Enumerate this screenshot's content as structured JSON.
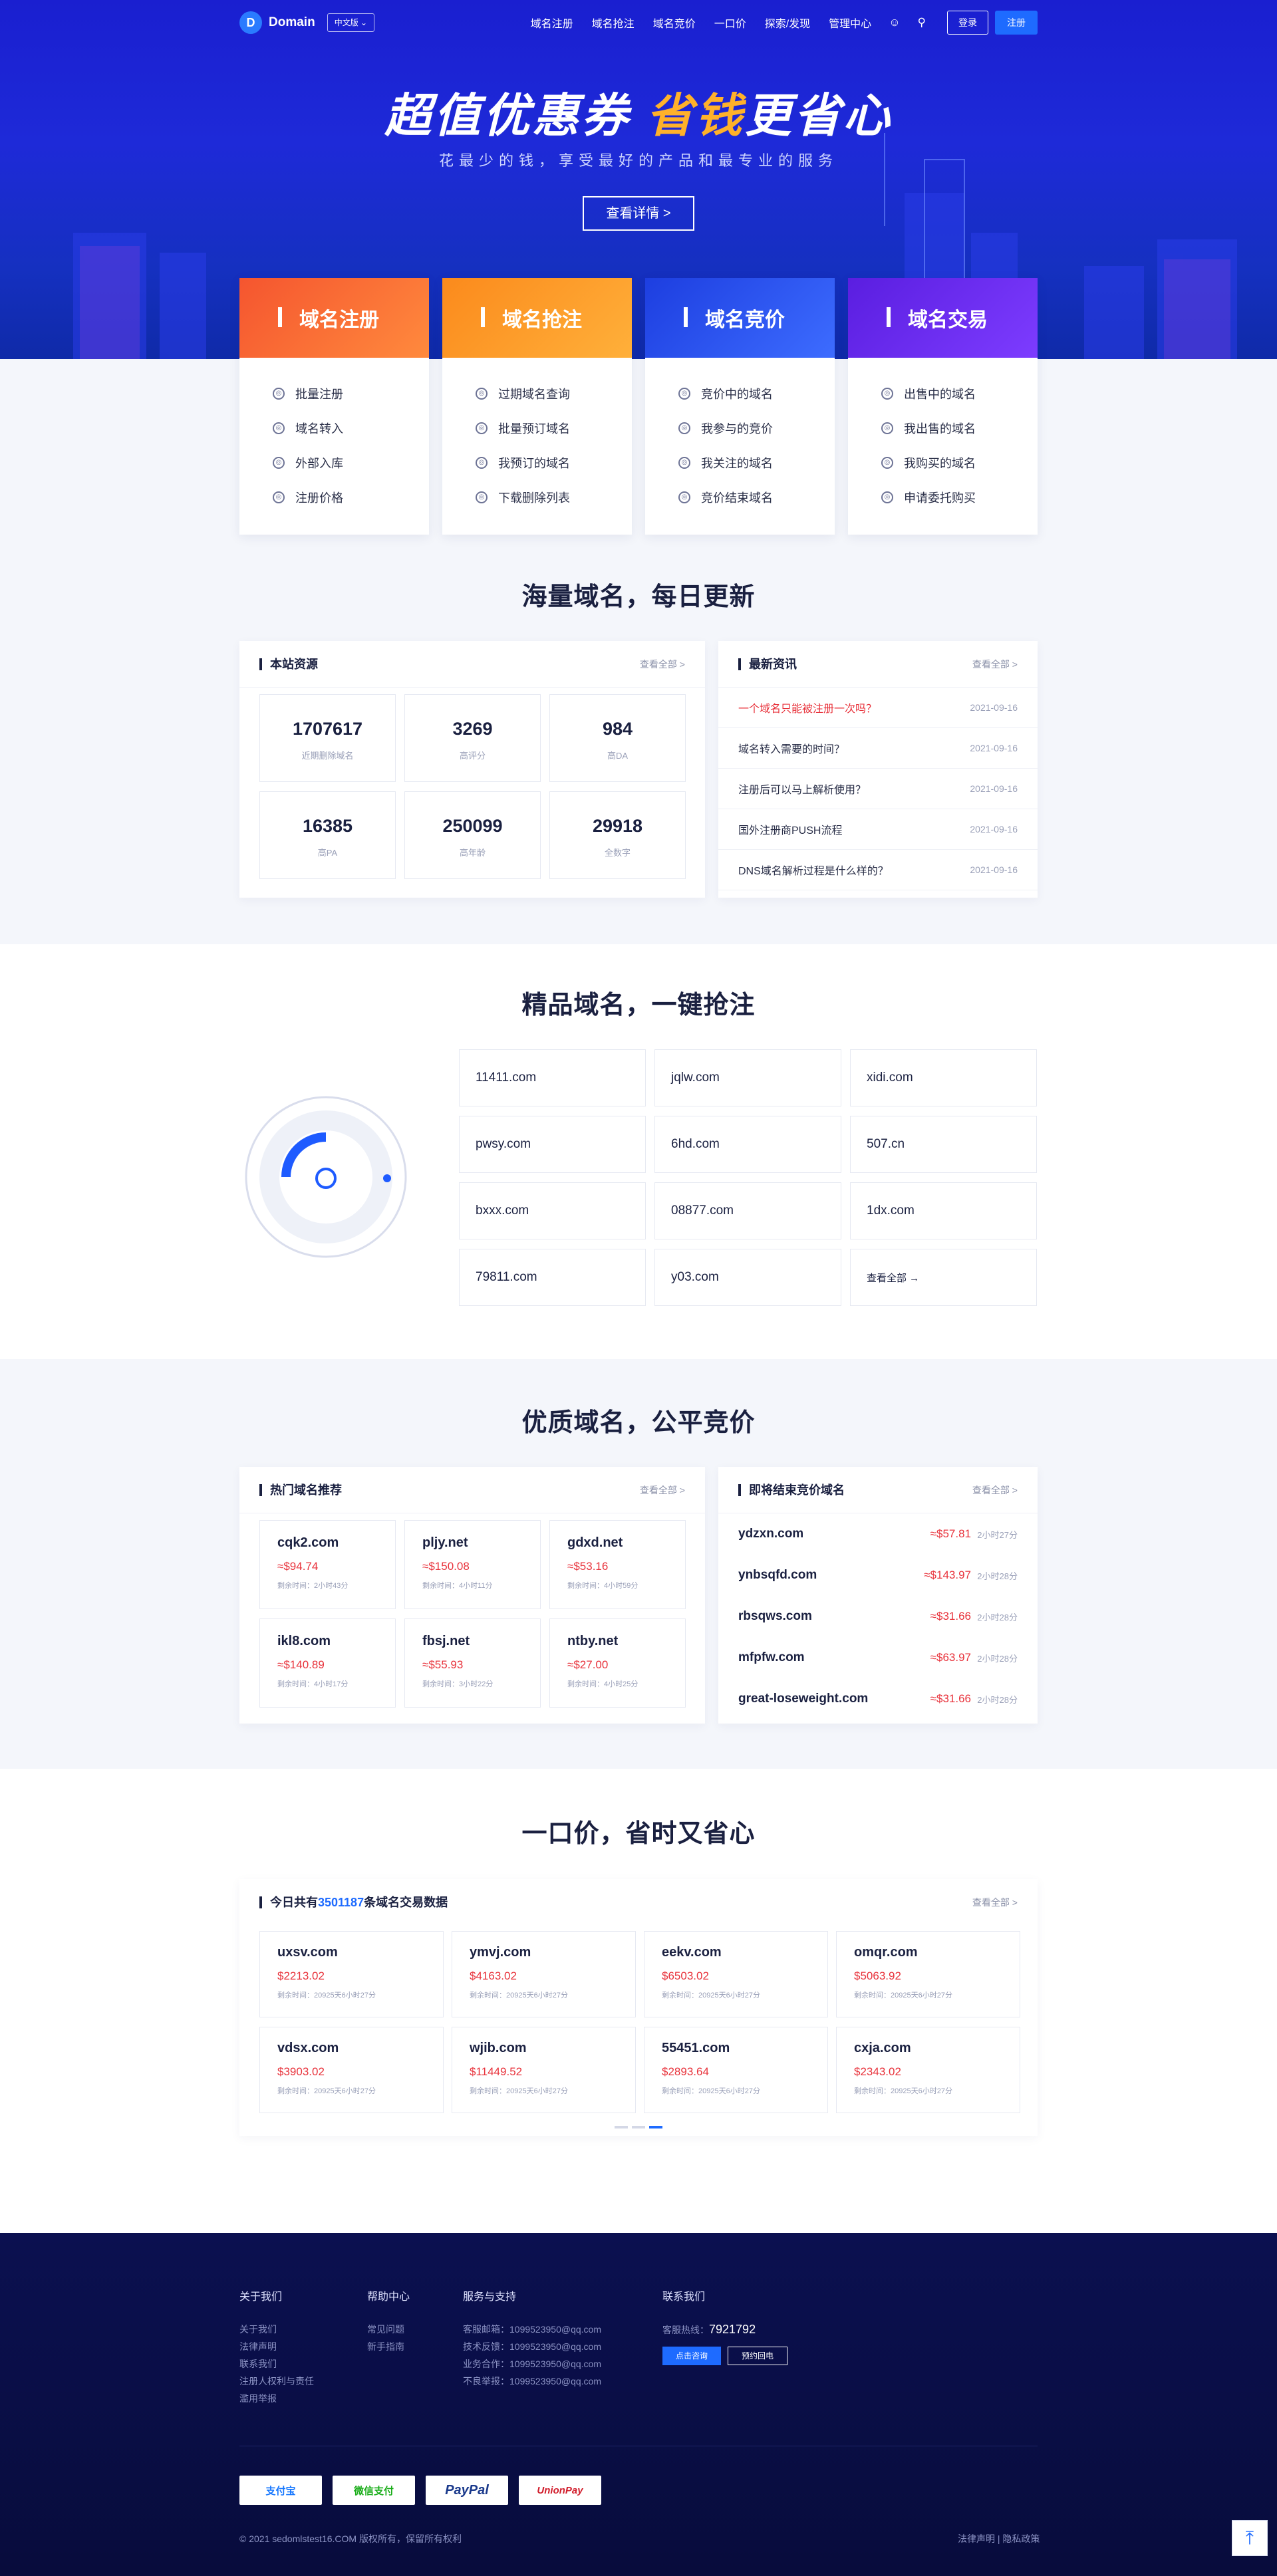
{
  "nav": {
    "logo_text": "Domain",
    "logo_letter": "D",
    "lang": "中文版",
    "menu": [
      "域名注册",
      "域名抢注",
      "域名竞价",
      "一口价",
      "探索/发现",
      "管理中心"
    ],
    "login": "登录",
    "register": "注册"
  },
  "hero": {
    "title_a": "超值优惠券",
    "title_b": "省钱",
    "title_c": "更省心",
    "subtitle": "花最少的钱，享受最好的产品和最专业的服务",
    "button": "查看详情 >"
  },
  "cats": [
    {
      "title": "域名注册",
      "color": "#f5552f",
      "color2": "#ff8a3d",
      "items": [
        "批量注册",
        "域名转入",
        "外部入库",
        "注册价格"
      ]
    },
    {
      "title": "域名抢注",
      "color": "#fb8a1c",
      "color2": "#ffb03a",
      "items": [
        "过期域名查询",
        "批量预订域名",
        "我预订的域名",
        "下载删除列表"
      ]
    },
    {
      "title": "域名竞价",
      "color": "#1d3ee0",
      "color2": "#3d6cff",
      "items": [
        "竞价中的域名",
        "我参与的竞价",
        "我关注的域名",
        "竞价结束域名"
      ]
    },
    {
      "title": "域名交易",
      "color": "#5a1ee0",
      "color2": "#7d3cff",
      "items": [
        "出售中的域名",
        "我出售的域名",
        "我购买的域名",
        "申请委托购买"
      ]
    }
  ],
  "sec1": {
    "title": "海量域名，每日更新"
  },
  "stats": {
    "title": "本站资源",
    "more": "查看全部 >",
    "items": [
      {
        "v": "1707617",
        "l": "近期删除域名"
      },
      {
        "v": "3269",
        "l": "高评分"
      },
      {
        "v": "984",
        "l": "高DA"
      },
      {
        "v": "16385",
        "l": "高PA"
      },
      {
        "v": "250099",
        "l": "高年龄"
      },
      {
        "v": "29918",
        "l": "全数字"
      }
    ]
  },
  "news": {
    "title": "最新资讯",
    "more": "查看全部 >",
    "items": [
      {
        "t": "一个域名只能被注册一次吗？",
        "d": "2021-09-16"
      },
      {
        "t": "域名转入需要的时间？",
        "d": "2021-09-16"
      },
      {
        "t": "注册后可以马上解析使用？",
        "d": "2021-09-16"
      },
      {
        "t": "国外注册商PUSH流程",
        "d": "2021-09-16"
      },
      {
        "t": "DNS域名解析过程是什么样的？",
        "d": "2021-09-16"
      }
    ]
  },
  "sec2": {
    "title": "精品域名，一键抢注"
  },
  "premium": [
    "11411.com",
    "jqlw.com",
    "xidi.com",
    "pwsy.com",
    "6hd.com",
    "507.cn",
    "bxxx.com",
    "08877.com",
    "1dx.com",
    "79811.com",
    "y03.com",
    "查看全部 →"
  ],
  "sec3": {
    "title": "优质域名，公平竞价"
  },
  "hot": {
    "title": "热门域名推荐",
    "more": "查看全部 >",
    "items": [
      {
        "n": "cqk2.com",
        "p": "≈$94.74",
        "t": "剩余时间：2小时43分"
      },
      {
        "n": "pljy.net",
        "p": "≈$150.08",
        "t": "剩余时间：4小时11分"
      },
      {
        "n": "gdxd.net",
        "p": "≈$53.16",
        "t": "剩余时间：4小时59分"
      },
      {
        "n": "ikl8.com",
        "p": "≈$140.89",
        "t": "剩余时间：4小时17分"
      },
      {
        "n": "fbsj.net",
        "p": "≈$55.93",
        "t": "剩余时间：3小时22分"
      },
      {
        "n": "ntby.net",
        "p": "≈$27.00",
        "t": "剩余时间：4小时25分"
      }
    ]
  },
  "auction": {
    "title": "即将结束竞价域名",
    "more": "查看全部 >",
    "items": [
      {
        "n": "ydzxn.com",
        "p": "≈$57.81",
        "t": "2小时27分"
      },
      {
        "n": "ynbsqfd.com",
        "p": "≈$143.97",
        "t": "2小时28分"
      },
      {
        "n": "rbsqws.com",
        "p": "≈$31.66",
        "t": "2小时28分"
      },
      {
        "n": "mfpfw.com",
        "p": "≈$63.97",
        "t": "2小时28分"
      },
      {
        "n": "great-loseweight.com",
        "p": "≈$31.66",
        "t": "2小时28分"
      }
    ]
  },
  "sec4": {
    "title": "一口价，省时又省心"
  },
  "fixed": {
    "title_a": "今日共有",
    "count": "3501187",
    "title_b": "条域名交易数据",
    "more": "查看全部 >",
    "items": [
      {
        "n": "uxsv.com",
        "p": "$2213.02",
        "t": "剩余时间：20925天6小时27分"
      },
      {
        "n": "ymvj.com",
        "p": "$4163.02",
        "t": "剩余时间：20925天6小时27分"
      },
      {
        "n": "eekv.com",
        "p": "$6503.02",
        "t": "剩余时间：20925天6小时27分"
      },
      {
        "n": "omqr.com",
        "p": "$5063.92",
        "t": "剩余时间：20925天6小时27分"
      },
      {
        "n": "vdsx.com",
        "p": "$3903.02",
        "t": "剩余时间：20925天6小时27分"
      },
      {
        "n": "wjib.com",
        "p": "$11449.52",
        "t": "剩余时间：20925天6小时27分"
      },
      {
        "n": "55451.com",
        "p": "$2893.64",
        "t": "剩余时间：20925天6小时27分"
      },
      {
        "n": "cxja.com",
        "p": "$2343.02",
        "t": "剩余时间：20925天6小时27分"
      }
    ]
  },
  "footer": {
    "about": {
      "h": "关于我们",
      "items": [
        "关于我们",
        "法律声明",
        "联系我们",
        "注册人权利与责任",
        "滥用举报"
      ]
    },
    "help": {
      "h": "帮助中心",
      "items": [
        "常见问题",
        "新手指南"
      ]
    },
    "service": {
      "h": "服务与支持",
      "items": [
        "客服邮箱：1099523950@qq.com",
        "技术反馈：1099523950@qq.com",
        "业务合作：1099523950@qq.com",
        "不良举报：1099523950@qq.com"
      ]
    },
    "contact": {
      "h": "联系我们",
      "hotline_label": "客服热线：",
      "hotline": "7921792",
      "btn1": "点击咨询",
      "btn2": "预约回电"
    },
    "pays": [
      "支付宝",
      "微信支付",
      "PayPal",
      "UnionPay"
    ],
    "copyright": "© 2021 sedomlstest16.COM 版权所有，保留所有权利",
    "legal": "法律声明 | 隐私政策"
  }
}
